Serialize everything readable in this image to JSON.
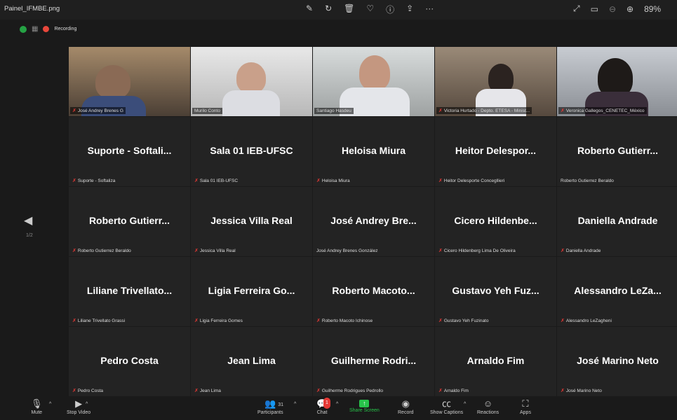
{
  "window": {
    "title": "Painel_IFMBE.png",
    "zoom": "89%"
  },
  "status": {
    "recording_label": "Recording"
  },
  "paging": {
    "label": "1/2"
  },
  "videos": [
    {
      "label": "José Andrey Brenes G",
      "muted": true
    },
    {
      "label": "Murilo Conto",
      "muted": false
    },
    {
      "label": "Santiago Hasdeu",
      "muted": false
    },
    {
      "label": "Victoria Hurtado - Depto. ETESA - Minist...",
      "muted": true
    },
    {
      "label": "Veronica Gallegos_CENETEC_México",
      "muted": true
    }
  ],
  "tiles": [
    {
      "big": "Suporte - Softali...",
      "label": "Suporte - Softaliza",
      "muted": true
    },
    {
      "big": "Sala 01 IEB-UFSC",
      "label": "Sala 01 IEB-UFSC",
      "muted": true
    },
    {
      "big": "Heloisa Miura",
      "label": "Heloisa Miura",
      "muted": true
    },
    {
      "big": "Heitor Delespor...",
      "label": "Heitor Delesporte Concegllieri",
      "muted": true
    },
    {
      "big": "Roberto Gutierr...",
      "label": "Roberto Gutierrez Beraldo",
      "muted": false
    },
    {
      "big": "Roberto Gutierr...",
      "label": "Roberto Gutierrez Beraldo",
      "muted": true
    },
    {
      "big": "Jessica Villa Real",
      "label": "Jessica Villa Real",
      "muted": true
    },
    {
      "big": "José Andrey Bre...",
      "label": "José Andrey Brenes González",
      "muted": false
    },
    {
      "big": "Cicero Hildenbe...",
      "label": "Cicero Hildenberg Lima De Oliveira",
      "muted": true
    },
    {
      "big": "Daniella Andrade",
      "label": "Daniella Andrade",
      "muted": true
    },
    {
      "big": "Liliane Trivellato...",
      "label": "Liliane Trivellato Grassi",
      "muted": true
    },
    {
      "big": "Ligia Ferreira Go...",
      "label": "Ligia Ferreira Gomes",
      "muted": true
    },
    {
      "big": "Roberto Macoto...",
      "label": "Roberto Macoto Ichinose",
      "muted": true
    },
    {
      "big": "Gustavo Yeh Fuz...",
      "label": "Gustavo Yeh Fuzinato",
      "muted": true
    },
    {
      "big": "Alessandro LeZa...",
      "label": "Alessandro LeZagheni",
      "muted": true
    },
    {
      "big": "Pedro Costa",
      "label": "Pedro Costa",
      "muted": true
    },
    {
      "big": "Jean Lima",
      "label": "Jean Lima",
      "muted": true
    },
    {
      "big": "Guilherme Rodri...",
      "label": "Guilherme Rodrigues Pedrollo",
      "muted": true
    },
    {
      "big": "Arnaldo Fim",
      "label": "Arnaldo Fim",
      "muted": true
    },
    {
      "big": "José Marino Neto",
      "label": "José Marino Neto",
      "muted": true
    }
  ],
  "toolbar": {
    "mute": "Mute",
    "stop_video": "Stop Video",
    "participants": "Participants",
    "participants_count": "31",
    "chat": "Chat",
    "chat_badge": "1",
    "share_screen": "Share Screen",
    "record": "Record",
    "show_captions": "Show Captions",
    "reactions": "Reactions",
    "apps": "Apps"
  },
  "colors": {
    "speaker_border": "#c8de2a",
    "share_green": "#27c44a",
    "muted_red": "#e53935"
  }
}
